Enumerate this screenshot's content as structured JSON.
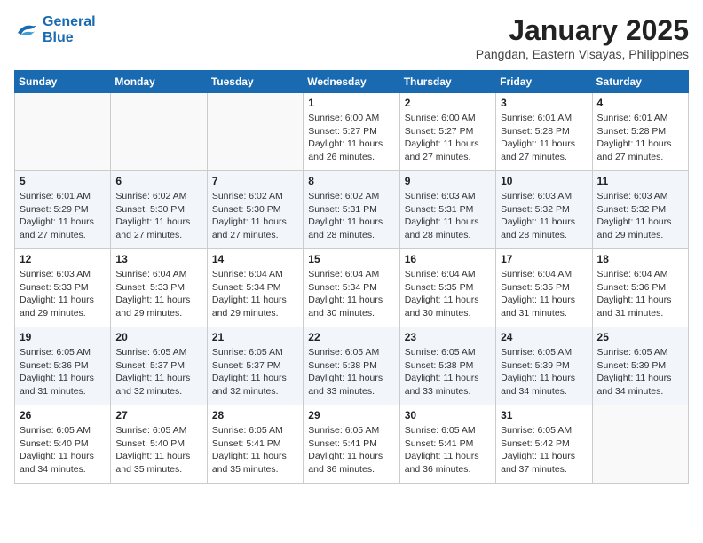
{
  "header": {
    "logo_line1": "General",
    "logo_line2": "Blue",
    "title": "January 2025",
    "subtitle": "Pangdan, Eastern Visayas, Philippines"
  },
  "weekdays": [
    "Sunday",
    "Monday",
    "Tuesday",
    "Wednesday",
    "Thursday",
    "Friday",
    "Saturday"
  ],
  "weeks": [
    [
      {
        "day": "",
        "info": ""
      },
      {
        "day": "",
        "info": ""
      },
      {
        "day": "",
        "info": ""
      },
      {
        "day": "1",
        "info": "Sunrise: 6:00 AM\nSunset: 5:27 PM\nDaylight: 11 hours\nand 26 minutes."
      },
      {
        "day": "2",
        "info": "Sunrise: 6:00 AM\nSunset: 5:27 PM\nDaylight: 11 hours\nand 27 minutes."
      },
      {
        "day": "3",
        "info": "Sunrise: 6:01 AM\nSunset: 5:28 PM\nDaylight: 11 hours\nand 27 minutes."
      },
      {
        "day": "4",
        "info": "Sunrise: 6:01 AM\nSunset: 5:28 PM\nDaylight: 11 hours\nand 27 minutes."
      }
    ],
    [
      {
        "day": "5",
        "info": "Sunrise: 6:01 AM\nSunset: 5:29 PM\nDaylight: 11 hours\nand 27 minutes."
      },
      {
        "day": "6",
        "info": "Sunrise: 6:02 AM\nSunset: 5:30 PM\nDaylight: 11 hours\nand 27 minutes."
      },
      {
        "day": "7",
        "info": "Sunrise: 6:02 AM\nSunset: 5:30 PM\nDaylight: 11 hours\nand 27 minutes."
      },
      {
        "day": "8",
        "info": "Sunrise: 6:02 AM\nSunset: 5:31 PM\nDaylight: 11 hours\nand 28 minutes."
      },
      {
        "day": "9",
        "info": "Sunrise: 6:03 AM\nSunset: 5:31 PM\nDaylight: 11 hours\nand 28 minutes."
      },
      {
        "day": "10",
        "info": "Sunrise: 6:03 AM\nSunset: 5:32 PM\nDaylight: 11 hours\nand 28 minutes."
      },
      {
        "day": "11",
        "info": "Sunrise: 6:03 AM\nSunset: 5:32 PM\nDaylight: 11 hours\nand 29 minutes."
      }
    ],
    [
      {
        "day": "12",
        "info": "Sunrise: 6:03 AM\nSunset: 5:33 PM\nDaylight: 11 hours\nand 29 minutes."
      },
      {
        "day": "13",
        "info": "Sunrise: 6:04 AM\nSunset: 5:33 PM\nDaylight: 11 hours\nand 29 minutes."
      },
      {
        "day": "14",
        "info": "Sunrise: 6:04 AM\nSunset: 5:34 PM\nDaylight: 11 hours\nand 29 minutes."
      },
      {
        "day": "15",
        "info": "Sunrise: 6:04 AM\nSunset: 5:34 PM\nDaylight: 11 hours\nand 30 minutes."
      },
      {
        "day": "16",
        "info": "Sunrise: 6:04 AM\nSunset: 5:35 PM\nDaylight: 11 hours\nand 30 minutes."
      },
      {
        "day": "17",
        "info": "Sunrise: 6:04 AM\nSunset: 5:35 PM\nDaylight: 11 hours\nand 31 minutes."
      },
      {
        "day": "18",
        "info": "Sunrise: 6:04 AM\nSunset: 5:36 PM\nDaylight: 11 hours\nand 31 minutes."
      }
    ],
    [
      {
        "day": "19",
        "info": "Sunrise: 6:05 AM\nSunset: 5:36 PM\nDaylight: 11 hours\nand 31 minutes."
      },
      {
        "day": "20",
        "info": "Sunrise: 6:05 AM\nSunset: 5:37 PM\nDaylight: 11 hours\nand 32 minutes."
      },
      {
        "day": "21",
        "info": "Sunrise: 6:05 AM\nSunset: 5:37 PM\nDaylight: 11 hours\nand 32 minutes."
      },
      {
        "day": "22",
        "info": "Sunrise: 6:05 AM\nSunset: 5:38 PM\nDaylight: 11 hours\nand 33 minutes."
      },
      {
        "day": "23",
        "info": "Sunrise: 6:05 AM\nSunset: 5:38 PM\nDaylight: 11 hours\nand 33 minutes."
      },
      {
        "day": "24",
        "info": "Sunrise: 6:05 AM\nSunset: 5:39 PM\nDaylight: 11 hours\nand 34 minutes."
      },
      {
        "day": "25",
        "info": "Sunrise: 6:05 AM\nSunset: 5:39 PM\nDaylight: 11 hours\nand 34 minutes."
      }
    ],
    [
      {
        "day": "26",
        "info": "Sunrise: 6:05 AM\nSunset: 5:40 PM\nDaylight: 11 hours\nand 34 minutes."
      },
      {
        "day": "27",
        "info": "Sunrise: 6:05 AM\nSunset: 5:40 PM\nDaylight: 11 hours\nand 35 minutes."
      },
      {
        "day": "28",
        "info": "Sunrise: 6:05 AM\nSunset: 5:41 PM\nDaylight: 11 hours\nand 35 minutes."
      },
      {
        "day": "29",
        "info": "Sunrise: 6:05 AM\nSunset: 5:41 PM\nDaylight: 11 hours\nand 36 minutes."
      },
      {
        "day": "30",
        "info": "Sunrise: 6:05 AM\nSunset: 5:41 PM\nDaylight: 11 hours\nand 36 minutes."
      },
      {
        "day": "31",
        "info": "Sunrise: 6:05 AM\nSunset: 5:42 PM\nDaylight: 11 hours\nand 37 minutes."
      },
      {
        "day": "",
        "info": ""
      }
    ]
  ]
}
